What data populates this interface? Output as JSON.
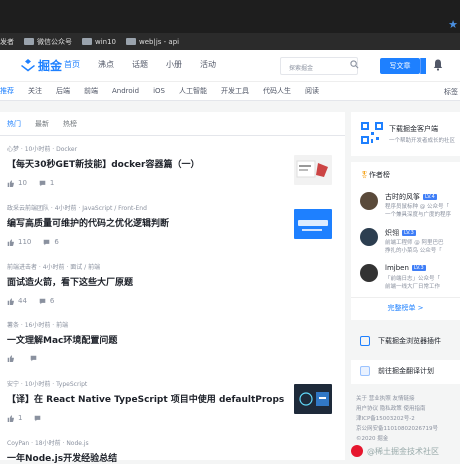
{
  "bookmarks": [
    {
      "label": "发者"
    },
    {
      "label": "微信公众号"
    },
    {
      "label": "win10"
    },
    {
      "label": "web|js - api"
    }
  ],
  "header": {
    "logo_text": "掘金",
    "nav": [
      "首页",
      "沸点",
      "话题",
      "小册",
      "活动"
    ],
    "search_placeholder": "探索掘金",
    "write_label": "写文章"
  },
  "subnav": {
    "items": [
      "推荐",
      "关注",
      "后端",
      "前端",
      "Android",
      "iOS",
      "人工智能",
      "开发工具",
      "代码人生",
      "阅读"
    ],
    "right": "标签"
  },
  "feed": {
    "tabs": [
      "热门",
      "最新",
      "热榜"
    ],
    "items": [
      {
        "meta": "心梦 · 10小时前 · Docker",
        "title": "【每天30秒GET新技能】docker容器篇（一）",
        "likes": "10",
        "comments": "1"
      },
      {
        "meta": "政采云前端团队 · 4小时前 · JavaScript / Front-End",
        "title": "编写高质量可维护的代码之优化逻辑判断",
        "likes": "110",
        "comments": "6"
      },
      {
        "meta": "前端进击者 · 4小时前 · 面试 / 前端",
        "title": "面试造火箭，看下这些大厂原题",
        "likes": "44",
        "comments": "6"
      },
      {
        "meta": "薯条 · 16小时前 · 前端",
        "title": "一文理解Mac环境配置问题",
        "likes": "",
        "comments": ""
      },
      {
        "meta": "安宁 · 10小时前 · TypeScript",
        "title": "【译】在 React Native TypeScript 项目中使用 defaultProps",
        "likes": "1",
        "comments": ""
      },
      {
        "meta": "CoyPan · 18小时前 · Node.js",
        "title": "一年Node.js开发经验总结",
        "likes": "",
        "comments": ""
      }
    ]
  },
  "sidebar": {
    "download": {
      "title": "下载掘金客户端",
      "desc": "一个帮助开发者成长的社区"
    },
    "authors_title": "作者榜",
    "authors": [
      {
        "name": "古时的风筝",
        "lv": "LV.4",
        "desc1": "程序员鼠标种 @ 公众号「",
        "desc2": "一个兼具深度与广度的程序"
      },
      {
        "name": "炽翎",
        "lv": "LV.3",
        "desc1": "前端工程师 @ 阿里巴巴",
        "desc2": "挣扎的小菜鸟 公众号「"
      },
      {
        "name": "lmjben",
        "lv": "LV.3",
        "desc1": "「前端日志」公众号「",
        "desc2": "前端一线大厂日常工作"
      }
    ],
    "more_label": "完整榜单 >",
    "ext_plugin": "下载掘金浏览器插件",
    "translate": "前往掘金翻译计划",
    "footer": [
      "关于   营业执照   友情链接",
      "用户协议   隐私政策   使用指南",
      "津ICP备15003202号-2",
      "京公网安备11010802026719号",
      "©2020 掘金"
    ],
    "watermark": "@稀土掘金技术社区"
  }
}
